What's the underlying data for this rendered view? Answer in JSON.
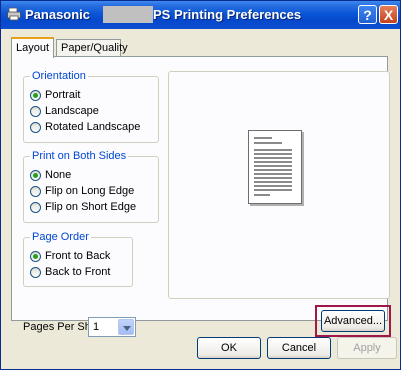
{
  "window": {
    "title_left": "Panasonic",
    "title_right": "PS Printing Preferences",
    "help_button": "?",
    "close_button": "X"
  },
  "tabs": [
    {
      "label": "Layout",
      "selected": true
    },
    {
      "label": "Paper/Quality",
      "selected": false
    }
  ],
  "orientation": {
    "title": "Orientation",
    "options": [
      {
        "label": "Portrait",
        "checked": true
      },
      {
        "label": "Landscape",
        "checked": false
      },
      {
        "label": "Rotated Landscape",
        "checked": false
      }
    ]
  },
  "print_both_sides": {
    "title": "Print on Both Sides",
    "options": [
      {
        "label": "None",
        "checked": true
      },
      {
        "label": "Flip on Long Edge",
        "checked": false
      },
      {
        "label": "Flip on Short Edge",
        "checked": false
      }
    ]
  },
  "page_order": {
    "title": "Page Order",
    "options": [
      {
        "label": "Front to Back",
        "checked": true
      },
      {
        "label": "Back to Front",
        "checked": false
      }
    ]
  },
  "pages_per_sheet": {
    "label": "Pages Per Sheet:",
    "value": "1"
  },
  "buttons": {
    "advanced": "Advanced...",
    "ok": "OK",
    "cancel": "Cancel",
    "apply": "Apply"
  },
  "colors": {
    "titlebar": "#0a55d6",
    "group_title": "#0046d5",
    "highlight_box": "#a0174a",
    "radio_dot": "#21a121"
  }
}
